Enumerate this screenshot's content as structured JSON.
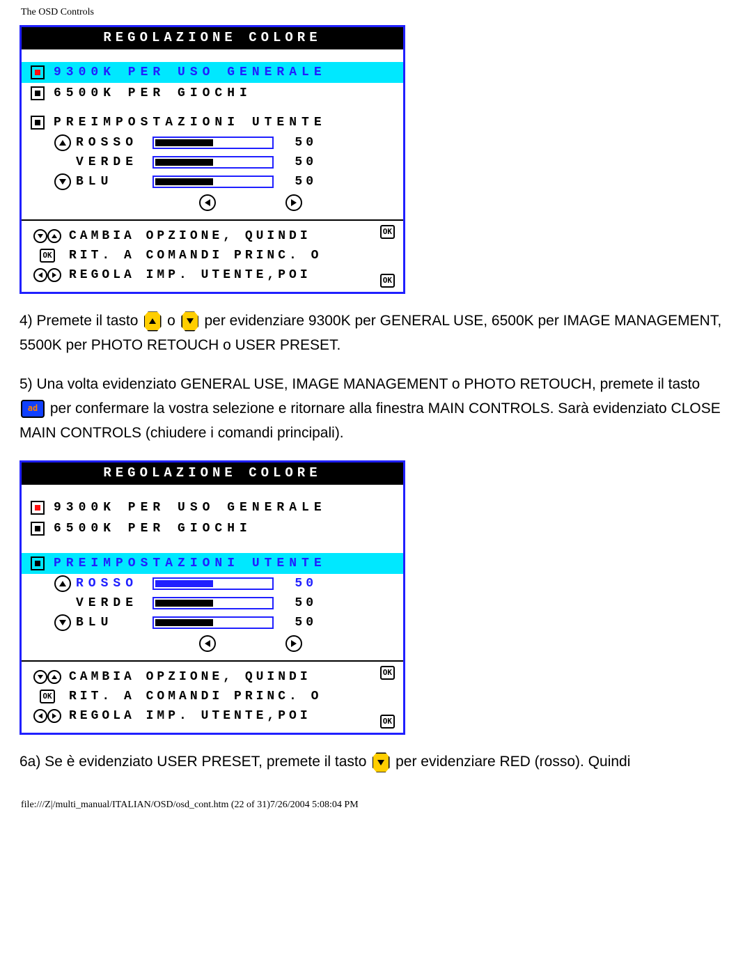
{
  "header": {
    "title": "The OSD Controls"
  },
  "panel1": {
    "title": "REGOLAZIONE COLORE",
    "opt1": "9300K PER USO GENERALE",
    "opt2": "6500K PER GIOCHI",
    "preset_label": "PREIMPOSTAZIONI UTENTE",
    "rgb": {
      "r_label": "ROSSO",
      "r_val": "50",
      "g_label": "VERDE",
      "g_val": "50",
      "b_label": "BLU",
      "b_val": "50"
    },
    "foot1": "CAMBIA OPZIONE, QUINDI",
    "foot2": "RIT. A COMANDI PRINC. O",
    "foot3": "REGOLA IMP. UTENTE,POI",
    "ok": "OK"
  },
  "body": {
    "p4a": "4) Premete il tasto",
    "p4b": "o",
    "p4c": "per evidenziare 9300K per GENERAL USE, 6500K per IMAGE MANAGEMENT, 5500K per PHOTO RETOUCH o USER PRESET.",
    "p5a": "5) Una volta evidenziato GENERAL USE, IMAGE MANAGEMENT o PHOTO RETOUCH, premete il tasto",
    "p5b": "per confermare la vostra selezione e ritornare alla finestra MAIN CONTROLS. Sarà evidenziato CLOSE MAIN CONTROLS (chiudere i comandi principali).",
    "p6a": "6a) Se è evidenziato USER PRESET, premete il tasto",
    "p6b": "per evidenziare RED (rosso). Quindi",
    "ok_inline": "ad"
  },
  "panel2": {
    "title": "REGOLAZIONE COLORE",
    "opt1": "9300K PER USO GENERALE",
    "opt2": "6500K PER GIOCHI",
    "preset_label": "PREIMPOSTAZIONI UTENTE",
    "rgb": {
      "r_label": "ROSSO",
      "r_val": "50",
      "g_label": "VERDE",
      "g_val": "50",
      "b_label": "BLU",
      "b_val": "50"
    },
    "foot1": "CAMBIA OPZIONE, QUINDI",
    "foot2": "RIT. A COMANDI PRINC. O",
    "foot3": "REGOLA IMP. UTENTE,POI",
    "ok": "OK"
  },
  "footer": {
    "text": "file:///Z|/multi_manual/ITALIAN/OSD/osd_cont.htm (22 of 31)7/26/2004 5:08:04 PM"
  }
}
